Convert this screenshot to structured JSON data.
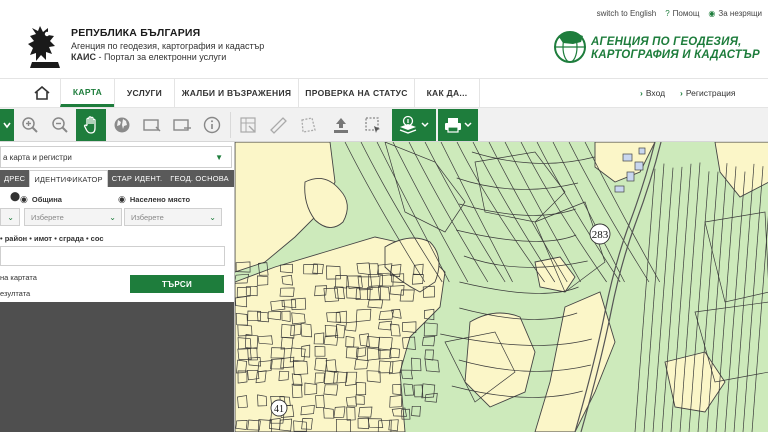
{
  "header": {
    "links": {
      "switch_lang": "switch to English",
      "help": "Помощ",
      "visually_impaired": "За незрящи"
    },
    "brand": {
      "title": "РЕПУБЛИКА БЪЛГАРИЯ",
      "subtitle": "Агенция по геодезия, картография и кадастър",
      "portal_prefix": "КАИС",
      "portal_text": " - Портал за електронни услуги"
    },
    "agency": {
      "line1": "АГЕНЦИЯ ПО ГЕОДЕЗИЯ,",
      "line2": "КАРТОГРАФИЯ И КАДАСТЪР"
    }
  },
  "nav": {
    "items": [
      "КАРТА",
      "УСЛУГИ",
      "ЖАЛБИ И ВЪЗРАЖЕНИЯ",
      "ПРОВЕРКА НА СТАТУС",
      "КАК ДА..."
    ],
    "active": "КАРТА",
    "login": "Вход",
    "register": "Регистрация"
  },
  "toolbar": {
    "tools": [
      "menu-toggle",
      "zoom-in",
      "zoom-out",
      "pan-hand",
      "globe",
      "select-rect",
      "select-rect-alt",
      "info",
      "measure-grid",
      "ruler",
      "polygon",
      "upload",
      "select-dashed",
      "layers",
      "print"
    ]
  },
  "sidebar": {
    "dropdown": "а карта и регистри",
    "tabs": [
      "ДРЕС",
      "ИДЕНТИФИКАТОР",
      "СТАР ИДЕНТ.",
      "ГЕОД. ОСНОВА"
    ],
    "active_tab": "ИДЕНТИФИКАТОР",
    "municipality_label": "Община",
    "settlement_label": "Населено място",
    "municipality_placeholder": "Изберете",
    "settlement_placeholder": "Изберете",
    "hint": "• район • имот • сграда • сос",
    "option1": "на картата",
    "option2": "езултата",
    "search_button": "ТЪРСИ"
  },
  "map": {
    "labels": [
      "283",
      "41"
    ]
  },
  "colors": {
    "brand_green": "#1e7d3c",
    "map_green": "#cdeabb",
    "map_yellow": "#fbf6c8",
    "parcel_line": "#3a3a3a"
  }
}
